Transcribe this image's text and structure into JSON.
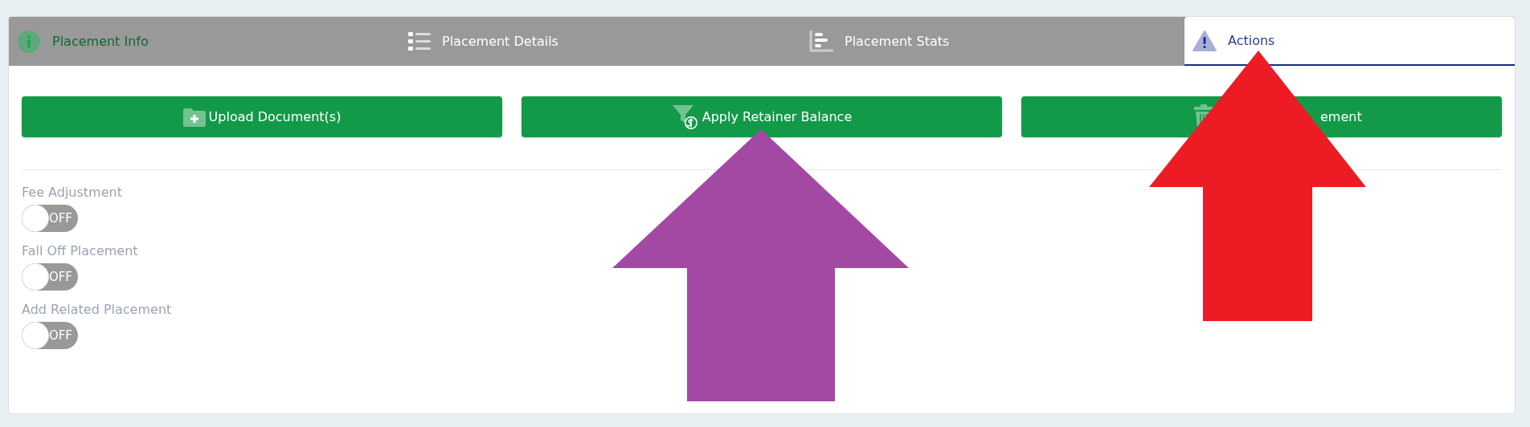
{
  "tabs": [
    {
      "label": "Placement Info",
      "kind": "highlighted",
      "selected": false
    },
    {
      "label": "Placement Details",
      "kind": "plain",
      "selected": false
    },
    {
      "label": "Placement Stats",
      "kind": "plain",
      "selected": false
    },
    {
      "label": "Actions",
      "kind": "plain",
      "selected": true
    }
  ],
  "action_buttons": [
    {
      "label": "Upload Document(s)",
      "kind": "full"
    },
    {
      "label": "Apply Retainer Balance",
      "kind": "full"
    },
    {
      "label": "ement",
      "kind": "partial"
    }
  ],
  "toggles": [
    {
      "label": "Fee Adjustment",
      "state_text": "OFF",
      "on": false
    },
    {
      "label": "Fall Off Placement",
      "state_text": "OFF",
      "on": false
    },
    {
      "label": "Add Related Placement",
      "state_text": "OFF",
      "on": false
    }
  ],
  "annotations": [
    {
      "kind": "arrow",
      "color": "#a349a4"
    },
    {
      "kind": "arrow",
      "color": "#ed1c24"
    }
  ]
}
